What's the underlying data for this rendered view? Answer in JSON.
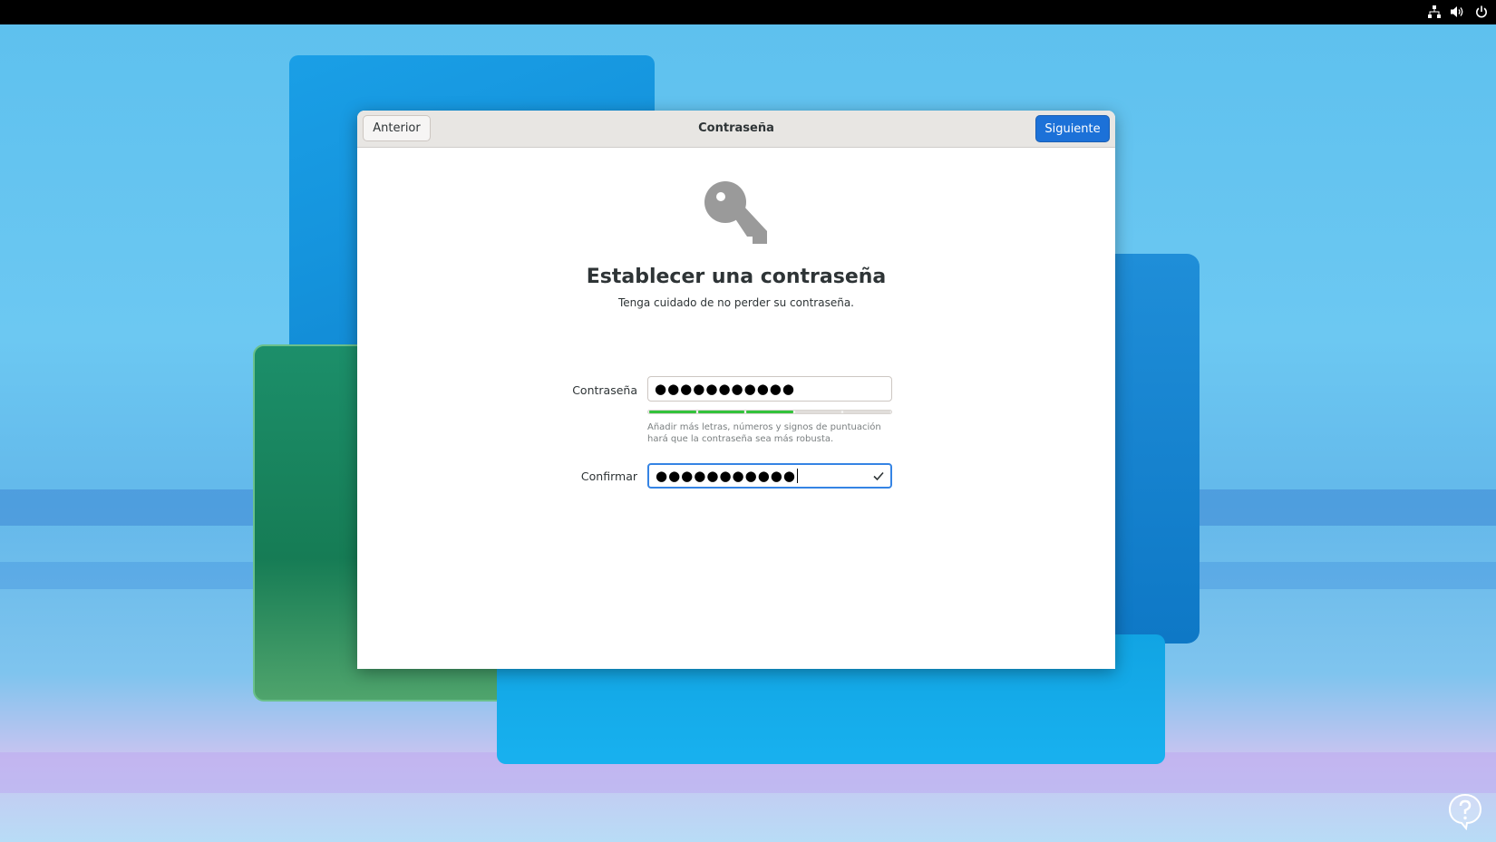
{
  "topbar": {
    "tray_icons": [
      "network-icon",
      "volume-icon",
      "power-icon"
    ]
  },
  "dialog": {
    "title": "Contraseña",
    "back_label": "Anterior",
    "next_label": "Siguiente",
    "heading": "Establecer una contraseña",
    "subheading": "Tenga cuidado de no perder su contraseña.",
    "password_label": "Contraseña",
    "password_value": "●●●●●●●●●●●",
    "strength_level": 0.6,
    "strength_hint": "Añadir más letras, números y signos de puntuación hará que la contraseña sea más robusta.",
    "confirm_label": "Confirmar",
    "confirm_value": "●●●●●●●●●●●",
    "confirm_status_icon": "check-icon"
  },
  "colors": {
    "accent": "#1c71d8",
    "focus_border": "#3584e4",
    "strength_fill": "#33c23b",
    "topbar": "#000000"
  }
}
